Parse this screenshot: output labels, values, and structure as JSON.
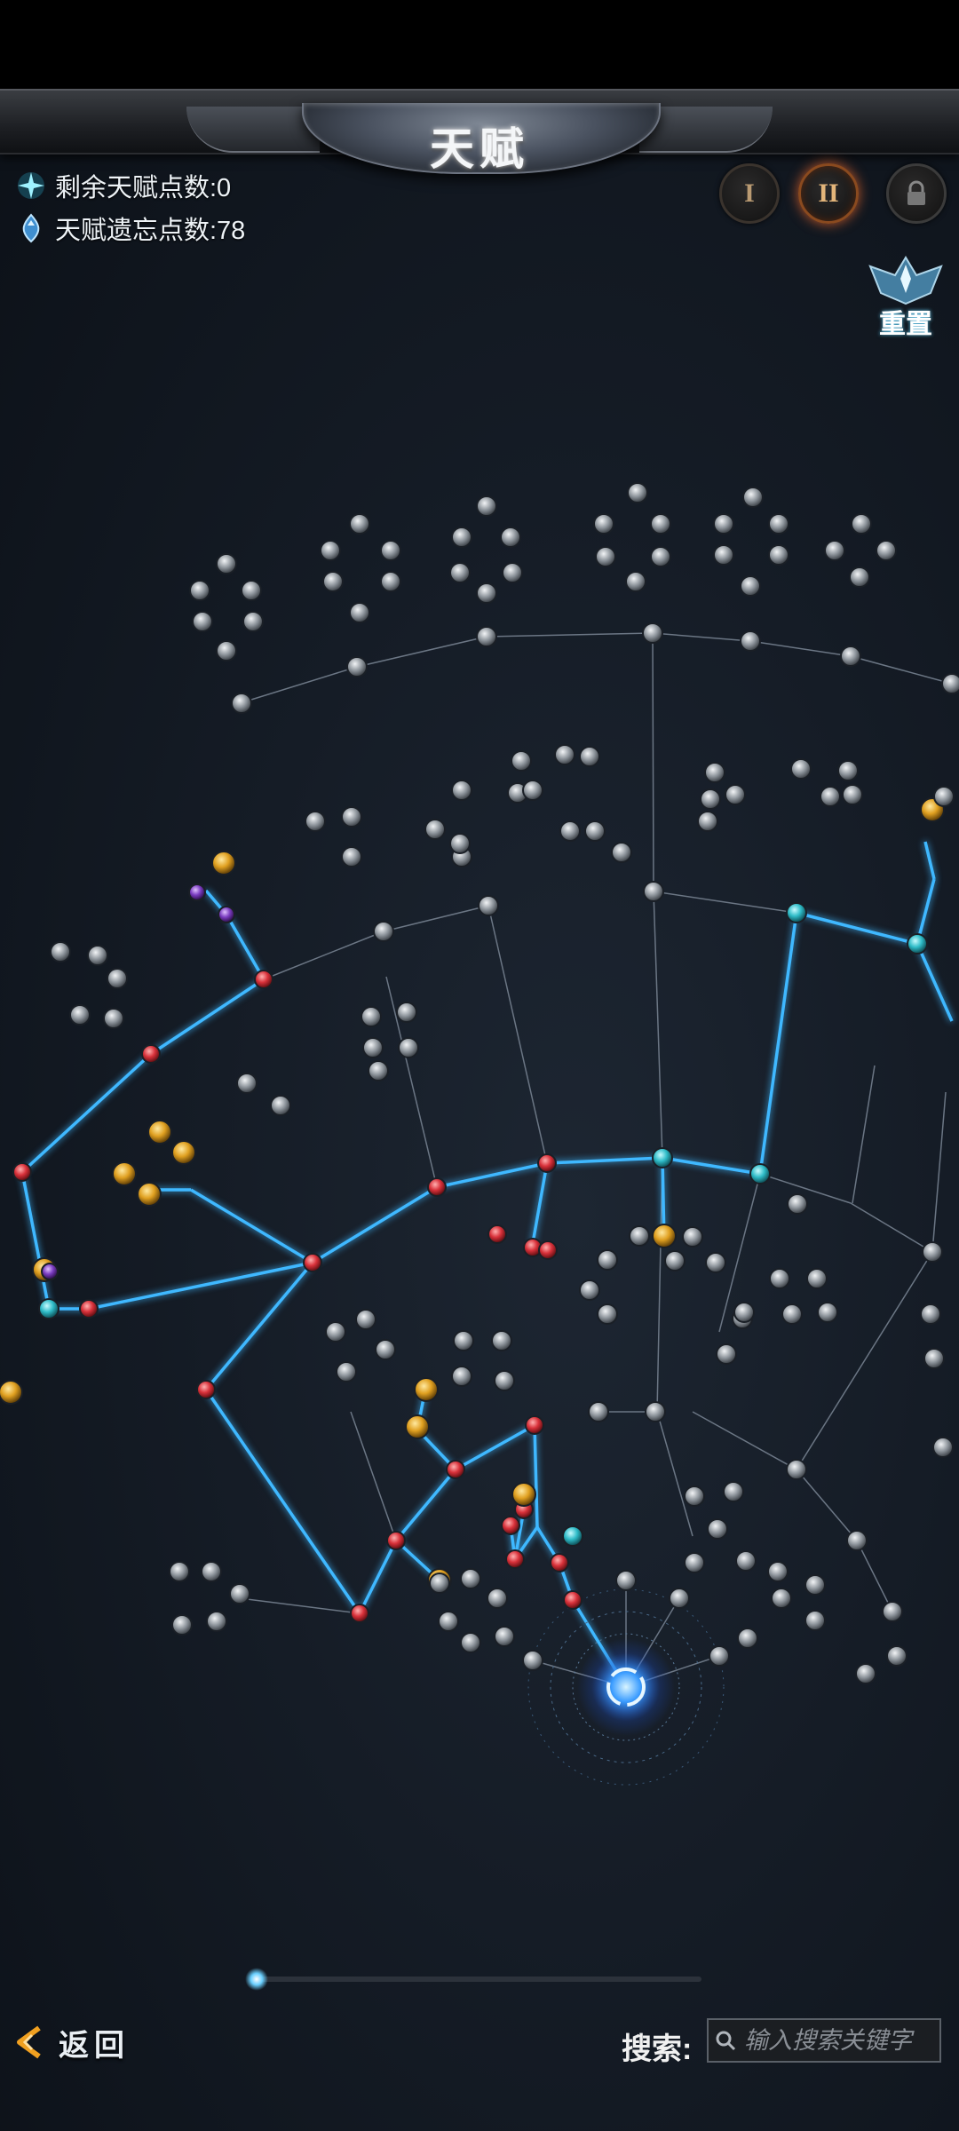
{
  "header": {
    "title": "天赋"
  },
  "stats": [
    {
      "label": "剩余天赋点数:0",
      "icon": "star-crystal-icon",
      "color": "#5fd8f0"
    },
    {
      "label": "天赋遗忘点数:78",
      "icon": "blue-gem-icon",
      "color": "#7fc6ff"
    }
  ],
  "pages": [
    {
      "label": "I",
      "state": "normal"
    },
    {
      "label": "II",
      "state": "active"
    },
    {
      "label": "",
      "state": "locked",
      "icon": "lock-icon"
    }
  ],
  "reset": {
    "label": "重置",
    "icon": "winged-crest-icon"
  },
  "footer": {
    "back_label": "返回",
    "search_label": "搜索:",
    "search_placeholder": "输入搜索关键字"
  },
  "colors": {
    "active_link": "#3fb8ff",
    "inactive_link": "#6b7684",
    "red_node": "#d8313a",
    "teal_node": "#2fbcc8",
    "gold_node": "#e0a020",
    "grey_node": "#aeb4ba"
  }
}
